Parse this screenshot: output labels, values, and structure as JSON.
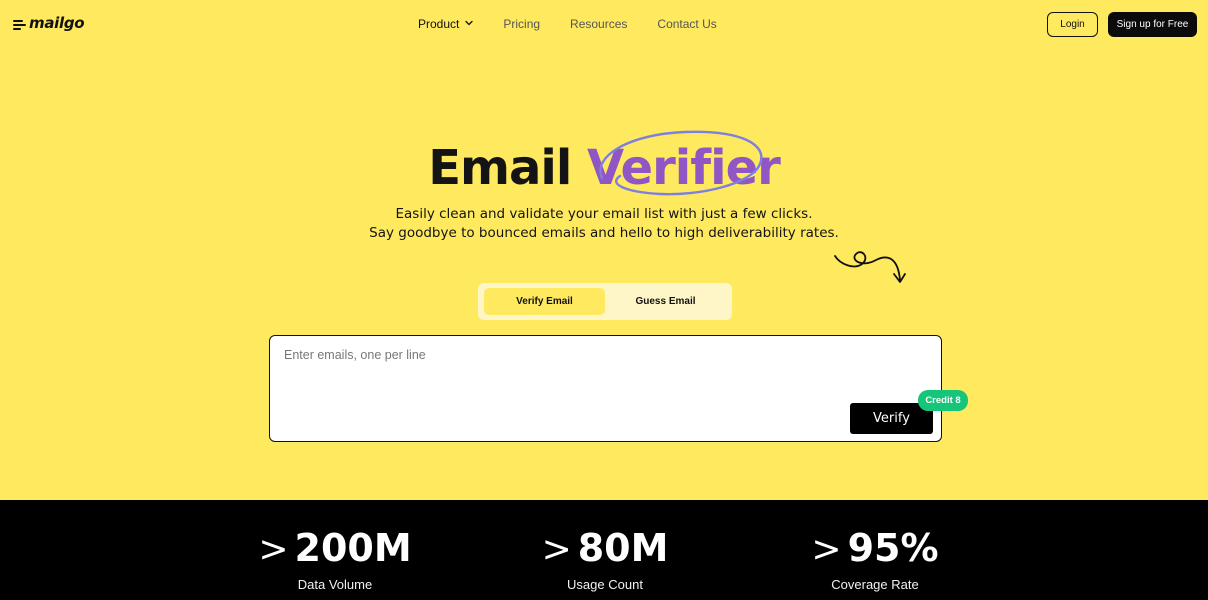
{
  "brand": {
    "name": "mailgo"
  },
  "nav": {
    "items": [
      {
        "label": "Product",
        "icon": "chevron-down-icon"
      },
      {
        "label": "Pricing"
      },
      {
        "label": "Resources"
      },
      {
        "label": "Contact Us"
      }
    ],
    "login_label": "Login",
    "signup_label": "Sign up for Free"
  },
  "hero": {
    "title_word1": "Email",
    "title_word2": "Verifier",
    "subtitle_line1": "Easily clean and validate your email list with just a few clicks.",
    "subtitle_line2": "Say goodbye to bounced emails and hello to high deliverability rates."
  },
  "tabs": [
    {
      "label": "Verify Email",
      "active": true
    },
    {
      "label": "Guess Email",
      "active": false
    }
  ],
  "verifier": {
    "placeholder": "Enter emails, one per line",
    "value": "",
    "button_label": "Verify",
    "credit_badge": "Credit 8"
  },
  "stats": [
    {
      "prefix": ">",
      "value": "200M",
      "label": "Data Volume"
    },
    {
      "prefix": ">",
      "value": "80M",
      "label": "Usage Count"
    },
    {
      "prefix": ">",
      "value": "95%",
      "label": "Coverage Rate"
    }
  ],
  "colors": {
    "background": "#FFE95F",
    "accent_purple": "#8F56C4",
    "oval_stroke": "#7E7FE0",
    "badge_green": "#16C47A",
    "dark": "#000000",
    "tab_track": "#FFF6C7"
  }
}
